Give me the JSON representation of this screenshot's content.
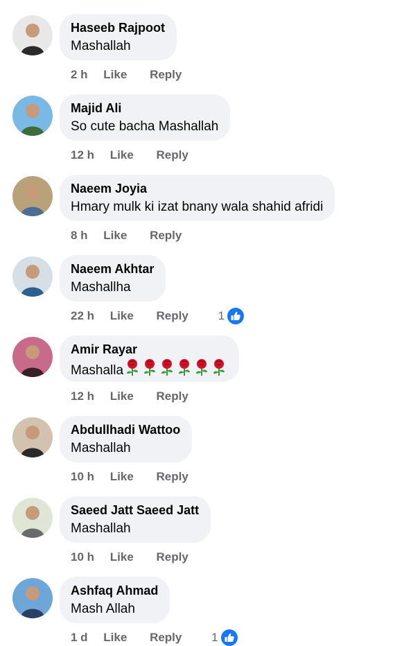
{
  "comments": [
    {
      "author": "Haseeb Rajpoot",
      "text": "Mashallah",
      "time": "2 h",
      "like_label": "Like",
      "reply_label": "Reply",
      "avatar_colors": {
        "bg": "#e8e8e8",
        "fg": "#2b2b2b"
      }
    },
    {
      "author": "Majid Ali",
      "text": "So cute bacha Mashallah",
      "time": "12 h",
      "like_label": "Like",
      "reply_label": "Reply",
      "avatar_colors": {
        "bg": "#7ab9e6",
        "fg": "#3f6b3a"
      }
    },
    {
      "author": "Naeem Joyia",
      "text": "Hmary mulk ki izat bnany wala shahid afridi",
      "time": "8 h",
      "like_label": "Like",
      "reply_label": "Reply",
      "avatar_colors": {
        "bg": "#b9a27a",
        "fg": "#4b6f93"
      }
    },
    {
      "author": "Naeem Akhtar",
      "text": "Mashallha",
      "time": "22 h",
      "like_label": "Like",
      "reply_label": "Reply",
      "reactions": "1",
      "avatar_colors": {
        "bg": "#d6dee6",
        "fg": "#2f5f8f"
      }
    },
    {
      "author": "Amir Rayar",
      "text": "Mashalla",
      "emoji_count": 6,
      "emoji": "rose-emoji",
      "time": "12 h",
      "like_label": "Like",
      "reply_label": "Reply",
      "avatar_colors": {
        "bg": "#c86a8a",
        "fg": "#3a1f2a"
      }
    },
    {
      "author": "Abdullhadi Wattoo",
      "text": "Mashallah",
      "time": "10 h",
      "like_label": "Like",
      "reply_label": "Reply",
      "avatar_colors": {
        "bg": "#d3c2b0",
        "fg": "#2a2a2a"
      }
    },
    {
      "author": "Saeed Jatt Saeed Jatt",
      "text": "Mashallah",
      "time": "10 h",
      "like_label": "Like",
      "reply_label": "Reply",
      "avatar_colors": {
        "bg": "#dfe6d6",
        "fg": "#6a6a6a"
      }
    },
    {
      "author": "Ashfaq Ahmad",
      "text": "Mash Allah",
      "time": "1 d",
      "like_label": "Like",
      "reply_label": "Reply",
      "reactions": "1",
      "avatar_colors": {
        "bg": "#6fa6d8",
        "fg": "#2a3f66"
      }
    }
  ],
  "colors": {
    "bubble": "#f0f2f5",
    "meta_text": "#65676b",
    "like_blue": "#1877f2",
    "rose_red": "#d3122b",
    "rose_green": "#3a9a3a"
  },
  "icons": {
    "like_reaction": "like-thumb-icon",
    "avatar": "profile-photo"
  }
}
